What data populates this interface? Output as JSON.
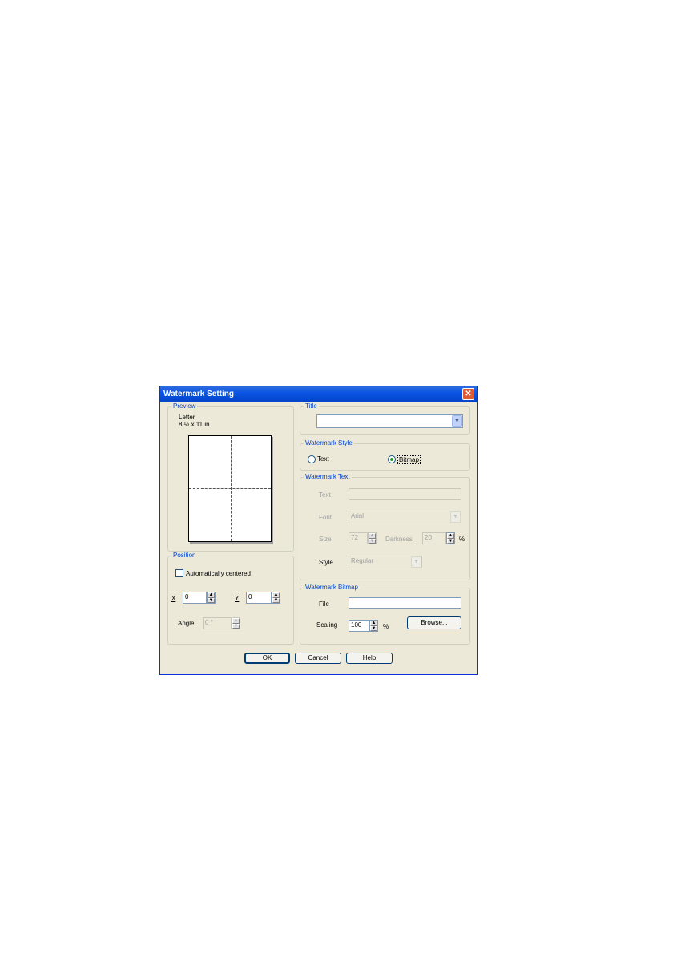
{
  "dialog": {
    "title": "Watermark Setting",
    "close_glyph": "✕"
  },
  "preview": {
    "legend": "Preview",
    "paper_name": "Letter",
    "paper_size": "8 ½ x 11 in"
  },
  "position": {
    "legend": "Position",
    "auto_center_label": "Automatically centered",
    "auto_center_checked": false,
    "x_label": "X",
    "x_value": "0",
    "y_label": "Y",
    "y_value": "0",
    "angle_label": "Angle",
    "angle_value": "0 °"
  },
  "title_group": {
    "legend": "Title",
    "value": ""
  },
  "watermark_style": {
    "legend": "Watermark Style",
    "text_label": "Text",
    "bitmap_label": "Bitmap",
    "selected": "bitmap"
  },
  "watermark_text": {
    "legend": "Watermark Text",
    "text_label": "Text",
    "text_value": "",
    "font_label": "Font",
    "font_value": "Arial",
    "size_label": "Size",
    "size_value": "72",
    "darkness_label": "Darkness",
    "darkness_value": "20",
    "percent": "%",
    "style_label": "Style",
    "style_value": "Regular"
  },
  "watermark_bitmap": {
    "legend": "Watermark Bitmap",
    "file_label": "File",
    "file_value": "",
    "scaling_label": "Scaling",
    "scaling_value": "100",
    "percent": "%",
    "browse_label": "Browse..."
  },
  "buttons": {
    "ok": "OK",
    "cancel": "Cancel",
    "help": "Help"
  },
  "colors": {
    "titlebar": "#0a54e3",
    "dialog_bg": "#ece9d8",
    "legend_text": "#0046d5",
    "close_button": "#e05a32"
  }
}
